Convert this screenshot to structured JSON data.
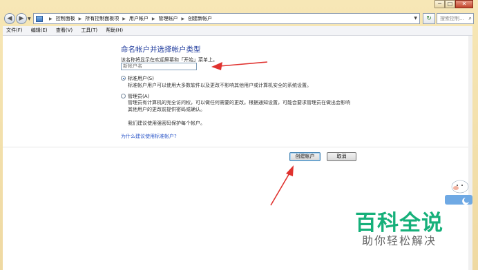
{
  "window_controls": {
    "minimize": "─",
    "maximize": "□",
    "close": "✕"
  },
  "address_bar": {
    "breadcrumbs": [
      "控制面板",
      "所有控制面板项",
      "用户帐户",
      "管理帐户",
      "创建新帐户"
    ],
    "search_placeholder": "搜索控制...",
    "icons": [
      "back-icon",
      "forward-icon",
      "control-panel-icon",
      "refresh-icon",
      "search-icon"
    ]
  },
  "menu": {
    "items": [
      "文件(F)",
      "编辑(E)",
      "查看(V)",
      "工具(T)",
      "帮助(H)"
    ]
  },
  "form": {
    "title": "命名帐户并选择帐户类型",
    "description": "该名称将显示在欢迎屏幕和「开始」菜单上。",
    "name_placeholder": "新帐户名",
    "options": [
      {
        "label": "标准用户(S)",
        "description": "标准帐户用户可以使用大多数软件以及更改不影响其他用户或计算机安全的系统设置。",
        "selected": true
      },
      {
        "label": "管理员(A)",
        "description_line1": "管理员有计算机的完全访问权，可以做任何需要的更改。根据通知设置，可能会要求管理员在做出会影响",
        "description_line2": "其他用户的更改前提供密码或确认。",
        "selected": false
      }
    ],
    "recommendation": "我们建议使用强密码保护每个帐户。",
    "help_link": "为什么建议使用标准帐户?"
  },
  "buttons": {
    "create": "创建帐户",
    "cancel": "取消"
  },
  "watermark": {
    "title": "百科全说",
    "subtitle": "助你轻松解决"
  },
  "colors": {
    "heading": "#1e3a9c",
    "link": "#2a55c8",
    "annotation_arrow": "#e0322f",
    "watermark": "#16b07a"
  }
}
